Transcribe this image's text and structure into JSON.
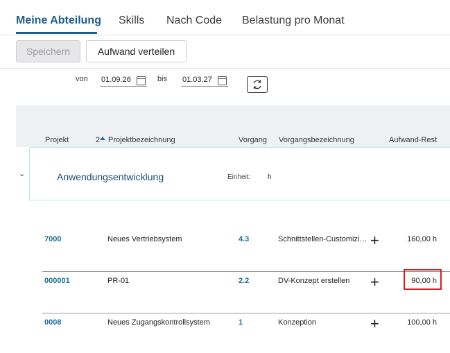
{
  "tabs": [
    {
      "label": "Meine Abteilung",
      "active": true
    },
    {
      "label": "Skills",
      "active": false
    },
    {
      "label": "Nach Code",
      "active": false
    },
    {
      "label": "Belastung pro Monat",
      "active": false
    }
  ],
  "toolbar": {
    "save_label": "Speichern",
    "distribute_label": "Aufwand verteilen"
  },
  "dates": {
    "from_label": "von",
    "from_value": "01.09.26",
    "to_label": "bis",
    "to_value": "01.03.27"
  },
  "table": {
    "headers": {
      "projekt": "Projekt",
      "sort_index": "2",
      "projektbezeichnung": "Projektbezeichnung",
      "vorgang": "Vorgang",
      "vorgangsbezeichnung": "Vorgangsbezeichnung",
      "aufwand_rest": "Aufwand-Rest"
    },
    "group": {
      "name": "Anwendungsentwicklung",
      "unit_label": "Einheit:",
      "unit_value": "h"
    },
    "rows": [
      {
        "projekt": "7000",
        "projektbezeichnung": "Neues Vertriebsystem",
        "vorgang": "4.3",
        "vorgangsbezeichnung": "Schnittstellen-Customizi…",
        "aufwand_rest": "160,00 h"
      },
      {
        "projekt": "000001",
        "projektbezeichnung": "PR-01",
        "vorgang": "2.2",
        "vorgangsbezeichnung": "DV-Konzept erstellen",
        "aufwand_rest": "90,00 h"
      },
      {
        "projekt": "0008",
        "projektbezeichnung": "Neues Zugangskontrollsystem",
        "vorgang": "1",
        "vorgangsbezeichnung": "Konzeption",
        "aufwand_rest": "100,00 h"
      }
    ]
  },
  "colors": {
    "accent": "#1b5e8c",
    "link": "#1b6f94",
    "highlight": "#d62020"
  },
  "icons": [
    "calendar-icon",
    "refresh-icon",
    "chevron-down-icon",
    "sort-asc-icon",
    "plus-icon"
  ]
}
